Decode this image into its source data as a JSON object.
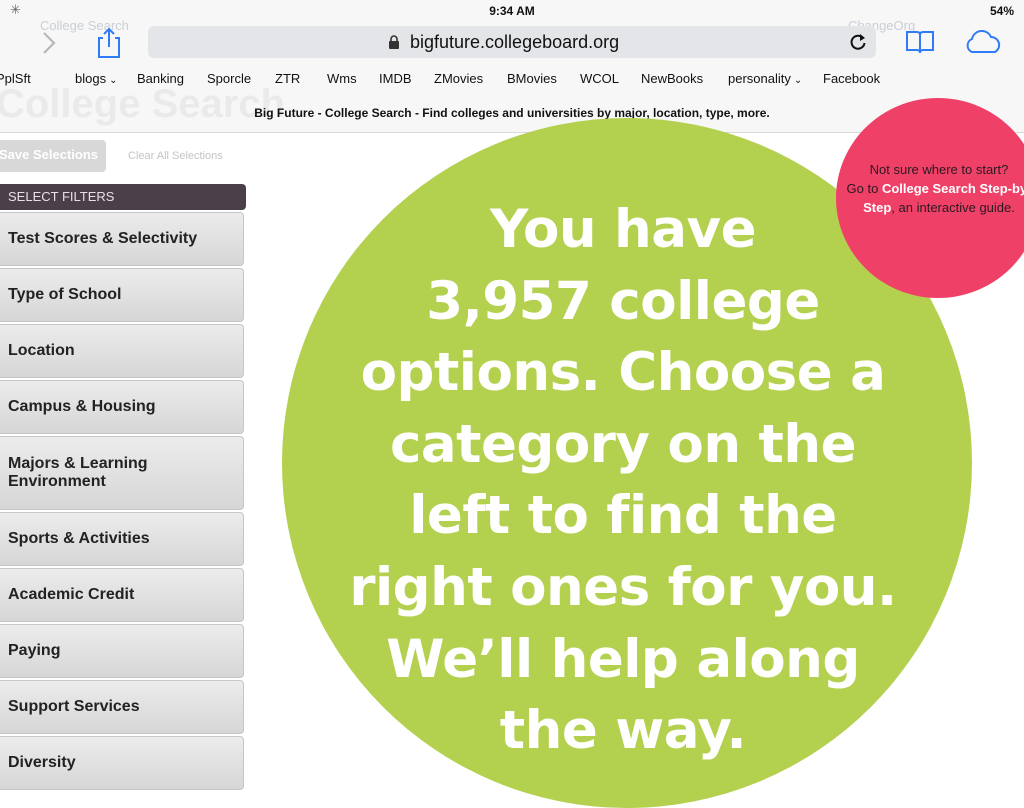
{
  "status_bar": {
    "time": "9:34 AM",
    "battery": "54%"
  },
  "browser": {
    "url": "bigfuture.collegeboard.org",
    "ghost_tab_left": "College Search",
    "ghost_tab_right": "ChangeOrg"
  },
  "favorites": [
    {
      "label": "PplSft",
      "chevron": ""
    },
    {
      "label": "blogs",
      "chevron": "⌄"
    },
    {
      "label": "Banking",
      "chevron": ""
    },
    {
      "label": "Sporcle",
      "chevron": ""
    },
    {
      "label": "ZTR",
      "chevron": ""
    },
    {
      "label": "Wms",
      "chevron": ""
    },
    {
      "label": "IMDB",
      "chevron": ""
    },
    {
      "label": "ZMovies",
      "chevron": ""
    },
    {
      "label": "BMovies",
      "chevron": ""
    },
    {
      "label": "WCOL",
      "chevron": ""
    },
    {
      "label": "NewBooks",
      "chevron": ""
    },
    {
      "label": "personality",
      "chevron": "⌄"
    },
    {
      "label": "Facebook",
      "chevron": ""
    }
  ],
  "page": {
    "ghost_heading": "College Search",
    "title": "Big Future - College Search - Find colleges and universities by major, location, type, more."
  },
  "actions": {
    "save_label": "Save Selections",
    "clear_label": "Clear All Selections"
  },
  "filters": {
    "header": "SELECT FILTERS",
    "items": [
      "Test Scores & Selectivity",
      "Type of School",
      "Location",
      "Campus & Housing",
      "Majors & Learning Environment",
      "Sports & Activities",
      "Academic Credit",
      "Paying",
      "Support Services",
      "Diversity"
    ]
  },
  "hero": {
    "lines": [
      "You have",
      "3,957 college",
      "options. Choose a",
      "category on the",
      "left to find the",
      "right ones for you.",
      "We’ll help along",
      "the way."
    ],
    "color": "#b4d04f"
  },
  "guide": {
    "intro": "Not sure where to start?",
    "go_to": "Go to",
    "link": "College Search Step-by-Step",
    "suffix": ", an interactive guide.",
    "color": "#ef4068"
  }
}
